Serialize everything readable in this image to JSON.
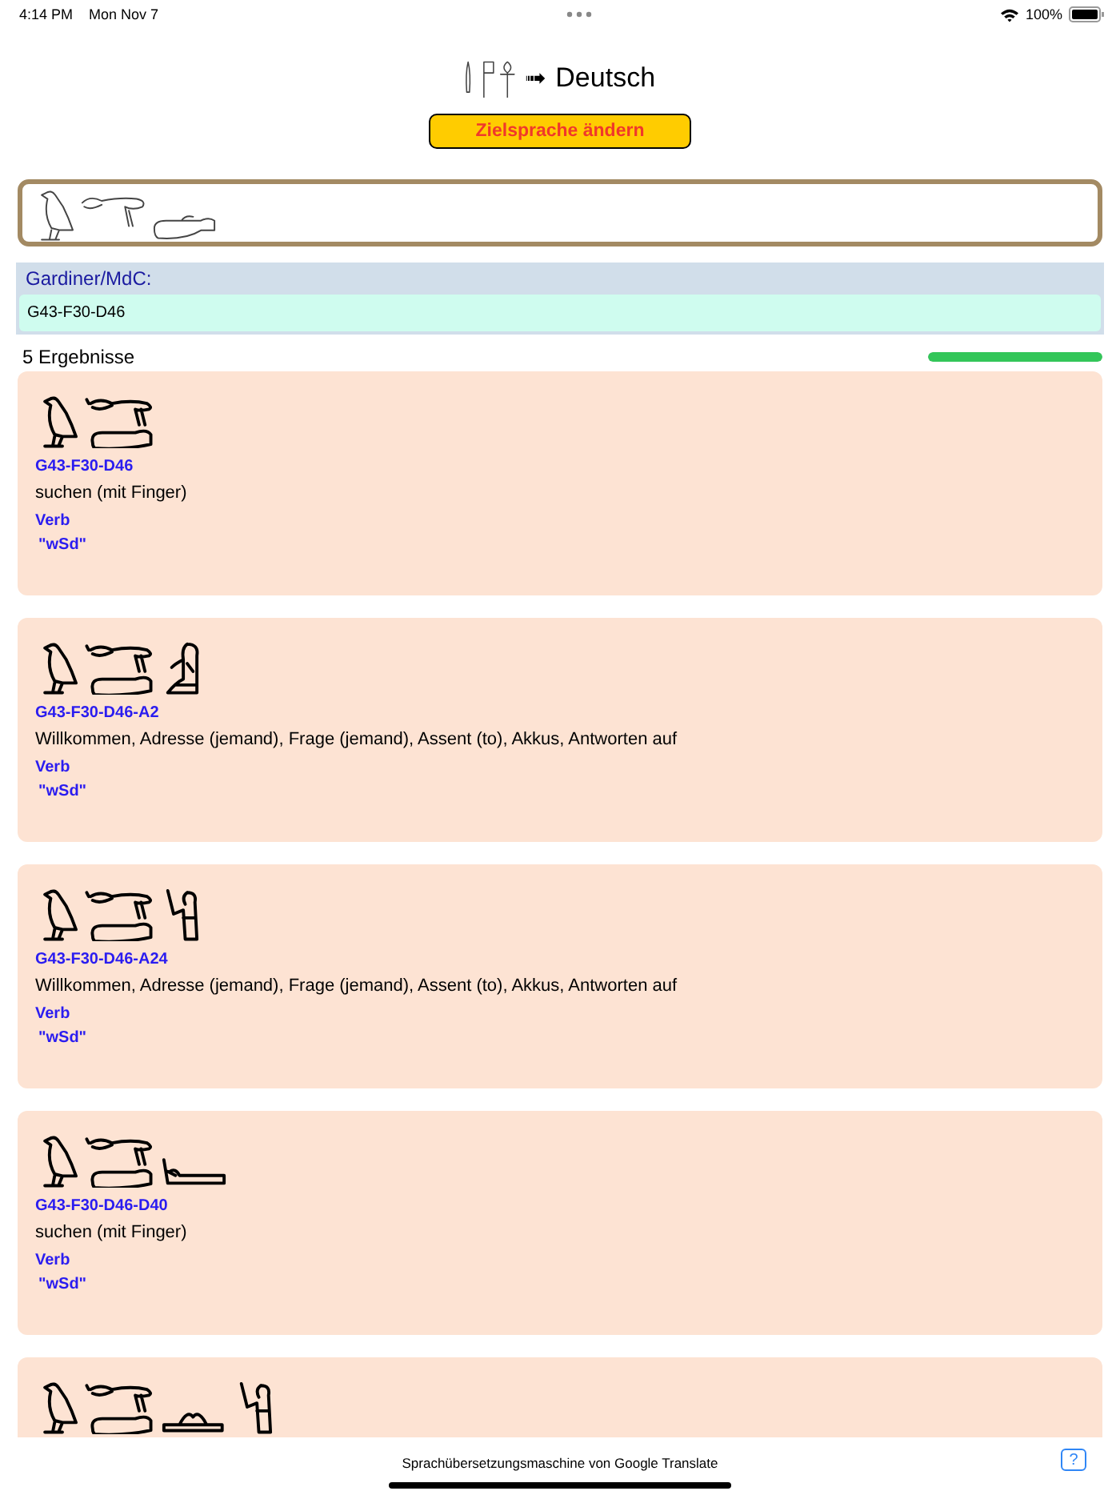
{
  "status_bar": {
    "time": "4:14 PM",
    "date": "Mon Nov 7",
    "battery": "100%"
  },
  "header": {
    "signs": [
      {
        "kind": "reed"
      },
      {
        "kind": "flag"
      },
      {
        "kind": "ankh"
      }
    ],
    "arrow": "➟",
    "language": "Deutsch"
  },
  "change_button": "Zielsprache ändern",
  "input": {
    "signs": [
      {
        "kind": "bird"
      },
      {
        "kind": "skin"
      },
      {
        "kind": "hand"
      }
    ]
  },
  "gardiner": {
    "label": "Gardiner/MdC:",
    "value": "G43-F30-D46"
  },
  "results": {
    "count": "5 Ergebnisse",
    "level": 1
  },
  "cards": [
    {
      "signs": [
        {
          "kind": "bird"
        },
        {
          "kind": "skin_hand"
        }
      ],
      "code": "G43-F30-D46",
      "meaning": "suchen (mit Finger)",
      "pos": "Verb",
      "translit": "\"wSd\""
    },
    {
      "signs": [
        {
          "kind": "bird"
        },
        {
          "kind": "skin_hand"
        },
        {
          "kind": "seated"
        }
      ],
      "code": "G43-F30-D46-A2",
      "meaning": "Willkommen, Adresse (jemand), Frage (jemand), Assent (to), Akkus, Antworten auf",
      "pos": "Verb",
      "translit": "\"wSd\""
    },
    {
      "signs": [
        {
          "kind": "bird"
        },
        {
          "kind": "skin_hand"
        },
        {
          "kind": "standing"
        }
      ],
      "code": "G43-F30-D46-A24",
      "meaning": "Willkommen, Adresse (jemand), Frage (jemand), Assent (to), Akkus, Antworten auf",
      "pos": "Verb",
      "translit": "\"wSd\""
    },
    {
      "signs": [
        {
          "kind": "bird"
        },
        {
          "kind": "skin_hand"
        },
        {
          "kind": "arm"
        }
      ],
      "code": "G43-F30-D46-D40",
      "meaning": "suchen (mit Finger)",
      "pos": "Verb",
      "translit": "\"wSd\""
    },
    {
      "signs": [
        {
          "kind": "bird"
        },
        {
          "kind": "skin_hand"
        },
        {
          "kind": "mound"
        },
        {
          "kind": "standing"
        }
      ]
    }
  ],
  "footer": {
    "credit": "Sprachübersetzungsmaschine von Google Translate",
    "help": "?"
  }
}
